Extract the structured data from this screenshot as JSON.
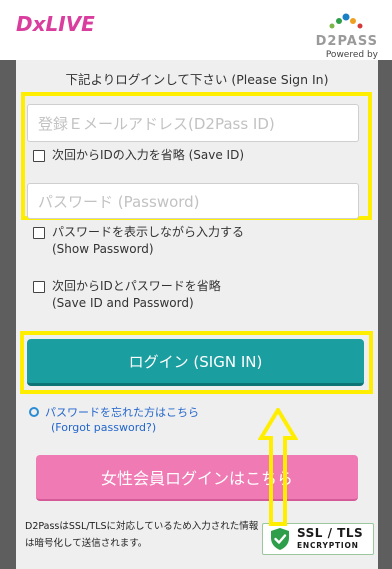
{
  "header": {
    "logo_text": "DxLIVE",
    "d2pass_text": "D2PASS",
    "d2pass_sub": "Powered by"
  },
  "login": {
    "instruction": "下記よりログインして下さい (Please Sign In)",
    "email_placeholder": "登録Ｅメールアドレス(D2Pass ID)",
    "save_id_label": "次回からIDの入力を省略 (Save ID)",
    "password_placeholder": "パスワード (Password)",
    "show_password_line1": "パスワードを表示しながら入力する",
    "show_password_line2": "(Show Password)",
    "save_both_line1": "次回からIDとパスワードを省略",
    "save_both_line2": "(Save ID and Password)",
    "login_button": "ログイン (SIGN IN)",
    "forgot_line1": "パスワードを忘れた方はこちら",
    "forgot_line2": "(Forgot password?)",
    "female_button": "女性会員ログインはこちら",
    "footer_line1": "D2PassはSSL/TLSに対応しているため入力された情報",
    "footer_line2": "は暗号化して送信されます。"
  },
  "ssl": {
    "title": "SSL / TLS",
    "subtitle": "ENCRYPTION"
  },
  "colors": {
    "brand_pink": "#d93e9e",
    "login_teal": "#1a9ea0",
    "female_pink": "#f07ab4",
    "highlight_yellow": "#ffee00",
    "ssl_green": "#2e9e4a"
  }
}
